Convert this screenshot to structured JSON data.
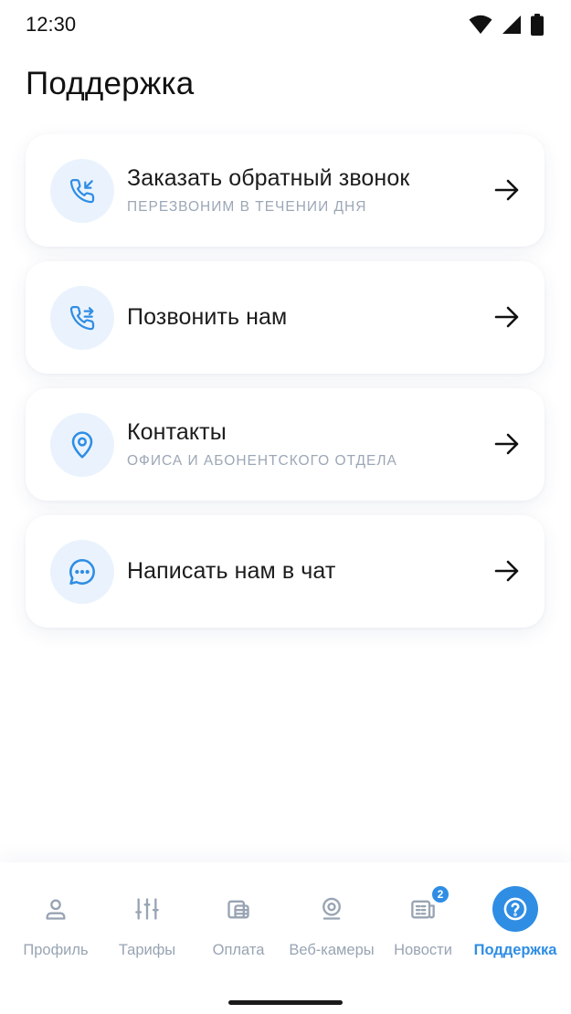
{
  "status_bar": {
    "time": "12:30",
    "icons": [
      "wifi-icon",
      "signal-icon",
      "battery-icon"
    ]
  },
  "page": {
    "title": "Поддержка"
  },
  "menu": [
    {
      "icon": "incoming-call-icon",
      "title": "Заказать обратный звонок",
      "subtitle": "ПЕРЕЗВОНИМ В ТЕЧЕНИИ ДНЯ"
    },
    {
      "icon": "outgoing-call-icon",
      "title": "Позвонить нам",
      "subtitle": ""
    },
    {
      "icon": "location-pin-icon",
      "title": "Контакты",
      "subtitle": "ОФИСА И АБОНЕНТСКОГО ОТДЕЛА"
    },
    {
      "icon": "chat-bubble-icon",
      "title": "Написать нам в чат",
      "subtitle": ""
    }
  ],
  "bottom_nav": {
    "items": [
      {
        "label": "Профиль",
        "icon": "user-icon",
        "active": false
      },
      {
        "label": "Тарифы",
        "icon": "sliders-icon",
        "active": false
      },
      {
        "label": "Оплата",
        "icon": "wallet-icon",
        "active": false
      },
      {
        "label": "Веб-камеры",
        "icon": "webcam-icon",
        "active": false
      },
      {
        "label": "Новости",
        "icon": "newspaper-icon",
        "active": false,
        "badge": "2"
      },
      {
        "label": "Поддержка",
        "icon": "help-icon",
        "active": true
      }
    ]
  },
  "colors": {
    "accent": "#2f8de4",
    "icon_bg": "#eaf3fd",
    "muted": "#98a4b3",
    "subtitle": "#9ca7b6",
    "text": "#1c1c1c"
  }
}
